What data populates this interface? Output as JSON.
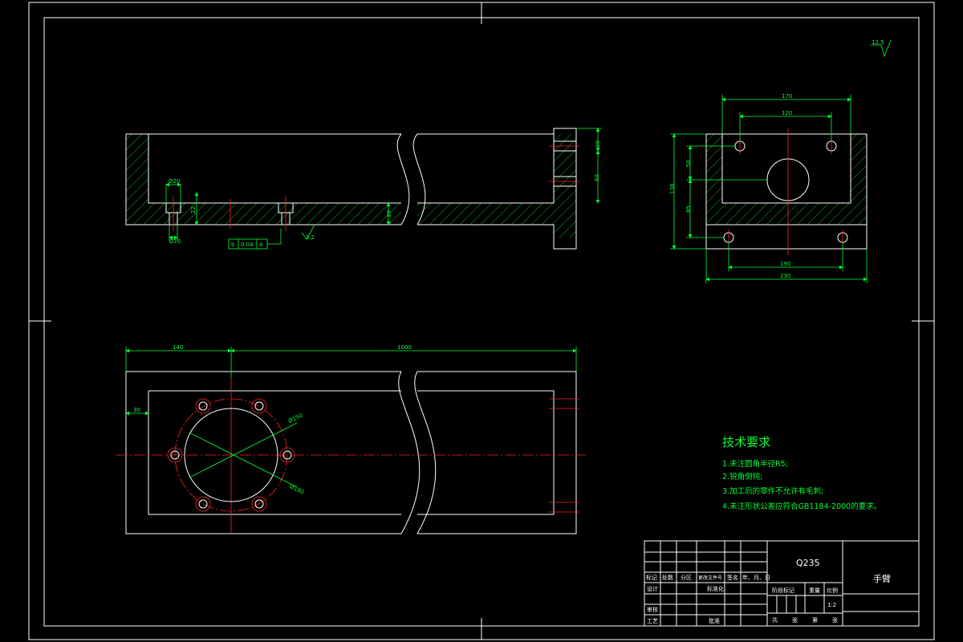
{
  "dimensions": {
    "top_view": {
      "d_top": "170",
      "d_inner": "120",
      "d_bottom_inner": "190",
      "d_bottom_total": "230",
      "d_height": "138",
      "d_upper": "50",
      "d_lower": "85"
    },
    "front_view": {
      "d_hole_w": "Ø20",
      "d_hole_b": "Ø10",
      "d_depth": "22",
      "d_right_1": "30",
      "d_right_2": "60",
      "d_wall": "20",
      "tolerance_datum": "b",
      "tolerance_value": "0.04",
      "tolerance_ref": "A",
      "roughness_value": "3.2"
    },
    "plan_view": {
      "d_left": "140",
      "d_total": "1000",
      "d_offset": "30",
      "d_dia_1": "Ø150",
      "d_dia_2": "Ø180"
    }
  },
  "roughness_corner": "12.5",
  "notes": {
    "heading": "技术要求",
    "items": [
      "1.未注圆角半径R5;",
      "2.锐角倒钝;",
      "3.加工后的零件不允许有毛刺;",
      "4.未注形状公差应符合GB1184-2000的要求。"
    ]
  },
  "title_block": {
    "material": "Q235",
    "part_name": "手臂",
    "header_labels": [
      "标记",
      "处数",
      "分区",
      "更改文件号",
      "签名",
      "年、月、日"
    ],
    "design_label": "设计",
    "standardize_label": "标准化",
    "review_label": "审核",
    "process_label": "工艺",
    "approve_label": "批准",
    "stage_label": "阶段标记",
    "weight_label": "重量",
    "scale_label": "比例",
    "scale_value": "1:2",
    "sheet_labels": [
      "共",
      "张",
      "第",
      "张"
    ]
  }
}
